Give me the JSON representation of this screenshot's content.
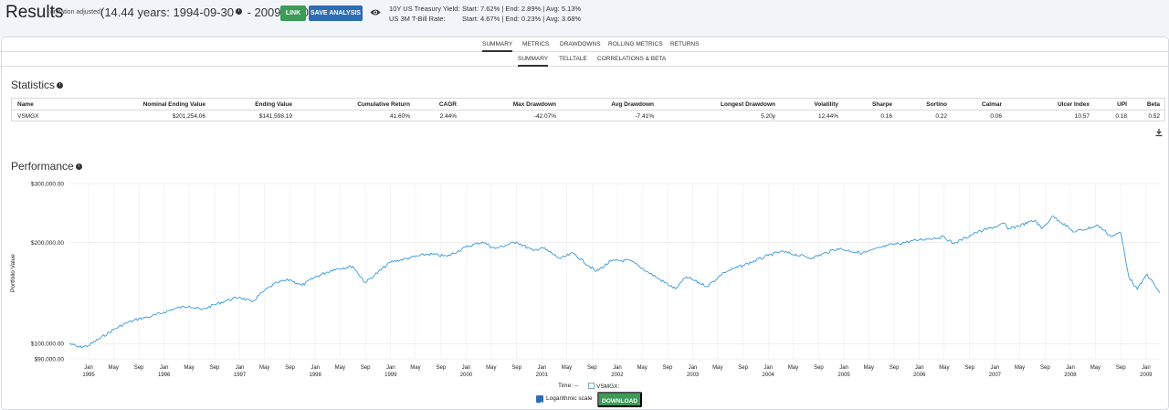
{
  "header": {
    "title": "Results",
    "inflation_note": "(inflation adjusted)",
    "years_prefix": "(14.44 years: 1994-09-30",
    "years_suffix": " - 2009-03-09)",
    "link_button": "LINK",
    "save_button": "SAVE ANALYSIS",
    "treasury_label": "10Y US Treasury Yield:",
    "treasury_values": "Start: 7.62%  |  End: 2.89%  |  Avg: 5.13%",
    "tbill_label": "US 3M T-Bill Rate:",
    "tbill_values": "Start: 4.67%  |  End: 0.23%  |  Avg: 3.68%"
  },
  "tabs": {
    "primary": [
      "SUMMARY",
      "METRICS",
      "DRAWDOWNS",
      "ROLLING METRICS",
      "RETURNS"
    ],
    "primary_active": "SUMMARY",
    "secondary": [
      "SUMMARY",
      "TELLTALE",
      "CORRELATIONS & BETA"
    ],
    "secondary_active": "SUMMARY"
  },
  "statistics": {
    "title": "Statistics",
    "columns": [
      "Name",
      "Nominal Ending Value",
      "Ending Value",
      "Cumulative Return",
      "CAGR",
      "Max Drawdown",
      "Avg Drawdown",
      "Longest Drawdown",
      "Volatility",
      "Sharpe",
      "Sortino",
      "Calmar",
      "Ulcer Index",
      "UPI",
      "Beta"
    ],
    "rows": [
      [
        "VSMGX",
        "$201,254.06",
        "$141,598.19",
        "41.60%",
        "2.44%",
        "-42.07%",
        "-7.41%",
        "5.20y",
        "12.44%",
        "0.16",
        "0.22",
        "0.06",
        "10.57",
        "0.18",
        "0.52"
      ]
    ]
  },
  "performance": {
    "title": "Performance",
    "time_label": "Time:",
    "time_value": "--",
    "series_legend": "VSMGX:",
    "log_scale_label": "Logarithmic scale",
    "download_button": "DOWNLOAD"
  },
  "chart_data": {
    "type": "line",
    "ylabel": "Portfolio Value",
    "yscale": "log",
    "ylim": [
      90000,
      300000
    ],
    "yticks": [
      "$300,000.00",
      "$200,000.00",
      "$100,000.00",
      "$90,000.00"
    ],
    "ytick_values": [
      300000,
      200000,
      100000,
      90000
    ],
    "xlim": [
      "1994-09-30",
      "2009-03-09"
    ],
    "x_ticks": [
      {
        "date": "1995-01",
        "label": "Jan",
        "year": "1995"
      },
      {
        "date": "1995-05",
        "label": "May"
      },
      {
        "date": "1995-09",
        "label": "Sep"
      },
      {
        "date": "1996-01",
        "label": "Jan",
        "year": "1996"
      },
      {
        "date": "1996-05",
        "label": "May"
      },
      {
        "date": "1996-09",
        "label": "Sep"
      },
      {
        "date": "1997-01",
        "label": "Jan",
        "year": "1997"
      },
      {
        "date": "1997-05",
        "label": "May"
      },
      {
        "date": "1997-09",
        "label": "Sep"
      },
      {
        "date": "1998-01",
        "label": "Jan",
        "year": "1998"
      },
      {
        "date": "1998-05",
        "label": "May"
      },
      {
        "date": "1998-09",
        "label": "Sep"
      },
      {
        "date": "1999-01",
        "label": "Jan",
        "year": "1999"
      },
      {
        "date": "1999-05",
        "label": "May"
      },
      {
        "date": "1999-09",
        "label": "Sep"
      },
      {
        "date": "2000-01",
        "label": "Jan",
        "year": "2000"
      },
      {
        "date": "2000-05",
        "label": "May"
      },
      {
        "date": "2000-09",
        "label": "Sep"
      },
      {
        "date": "2001-01",
        "label": "Jan",
        "year": "2001"
      },
      {
        "date": "2001-05",
        "label": "May"
      },
      {
        "date": "2001-09",
        "label": "Sep"
      },
      {
        "date": "2002-01",
        "label": "Jan",
        "year": "2002"
      },
      {
        "date": "2002-05",
        "label": "May"
      },
      {
        "date": "2002-09",
        "label": "Sep"
      },
      {
        "date": "2003-01",
        "label": "Jan",
        "year": "2003"
      },
      {
        "date": "2003-05",
        "label": "May"
      },
      {
        "date": "2003-09",
        "label": "Sep"
      },
      {
        "date": "2004-01",
        "label": "Jan",
        "year": "2004"
      },
      {
        "date": "2004-05",
        "label": "May"
      },
      {
        "date": "2004-09",
        "label": "Sep"
      },
      {
        "date": "2005-01",
        "label": "Jan",
        "year": "2005"
      },
      {
        "date": "2005-05",
        "label": "May"
      },
      {
        "date": "2005-09",
        "label": "Sep"
      },
      {
        "date": "2006-01",
        "label": "Jan",
        "year": "2006"
      },
      {
        "date": "2006-05",
        "label": "May"
      },
      {
        "date": "2006-09",
        "label": "Sep"
      },
      {
        "date": "2007-01",
        "label": "Jan",
        "year": "2007"
      },
      {
        "date": "2007-05",
        "label": "May"
      },
      {
        "date": "2007-09",
        "label": "Sep"
      },
      {
        "date": "2008-01",
        "label": "Jan",
        "year": "2008"
      },
      {
        "date": "2008-05",
        "label": "May"
      },
      {
        "date": "2008-09",
        "label": "Sep"
      },
      {
        "date": "2009-01",
        "label": "Jan",
        "year": "2009"
      }
    ],
    "series": [
      {
        "name": "VSMGX",
        "color": "#3a9ad9",
        "points": [
          [
            "1994-09-30",
            100000
          ],
          [
            "1994-11-15",
            97500
          ],
          [
            "1994-12-30",
            98500
          ],
          [
            "1995-03-01",
            104000
          ],
          [
            "1995-05-01",
            110000
          ],
          [
            "1995-07-01",
            115000
          ],
          [
            "1995-09-01",
            118500
          ],
          [
            "1995-11-01",
            120500
          ],
          [
            "1996-01-01",
            124000
          ],
          [
            "1996-03-01",
            127500
          ],
          [
            "1996-05-01",
            129500
          ],
          [
            "1996-07-01",
            126000
          ],
          [
            "1996-09-01",
            130500
          ],
          [
            "1996-11-01",
            134500
          ],
          [
            "1997-01-01",
            137500
          ],
          [
            "1997-03-01",
            133000
          ],
          [
            "1997-05-01",
            144000
          ],
          [
            "1997-07-01",
            152000
          ],
          [
            "1997-09-01",
            155000
          ],
          [
            "1997-10-28",
            149000
          ],
          [
            "1998-01-01",
            158000
          ],
          [
            "1998-04-01",
            166500
          ],
          [
            "1998-07-01",
            170000
          ],
          [
            "1998-08-31",
            152000
          ],
          [
            "1998-10-15",
            160000
          ],
          [
            "1999-01-01",
            175000
          ],
          [
            "1999-04-01",
            180000
          ],
          [
            "1999-07-01",
            185000
          ],
          [
            "1999-10-01",
            182000
          ],
          [
            "2000-01-01",
            194000
          ],
          [
            "2000-03-20",
            201000
          ],
          [
            "2000-05-20",
            192000
          ],
          [
            "2000-09-01",
            201000
          ],
          [
            "2000-11-20",
            189000
          ],
          [
            "2001-01-01",
            193500
          ],
          [
            "2001-04-01",
            179000
          ],
          [
            "2001-06-01",
            186000
          ],
          [
            "2001-09-21",
            164000
          ],
          [
            "2001-12-01",
            176000
          ],
          [
            "2002-03-01",
            177000
          ],
          [
            "2002-07-20",
            156000
          ],
          [
            "2002-10-09",
            145500
          ],
          [
            "2002-12-01",
            158000
          ],
          [
            "2003-03-11",
            148000
          ],
          [
            "2003-06-01",
            163000
          ],
          [
            "2003-09-01",
            171000
          ],
          [
            "2004-01-01",
            183000
          ],
          [
            "2004-03-01",
            188000
          ],
          [
            "2004-08-01",
            180000
          ],
          [
            "2004-12-01",
            192000
          ],
          [
            "2005-04-01",
            186000
          ],
          [
            "2005-08-01",
            196000
          ],
          [
            "2006-01-01",
            204000
          ],
          [
            "2006-05-01",
            208000
          ],
          [
            "2006-06-15",
            198500
          ],
          [
            "2006-10-01",
            214000
          ],
          [
            "2007-02-20",
            228000
          ],
          [
            "2007-03-05",
            219000
          ],
          [
            "2007-07-15",
            233000
          ],
          [
            "2007-08-15",
            220000
          ],
          [
            "2007-10-10",
            240000
          ],
          [
            "2008-01-20",
            215000
          ],
          [
            "2008-05-15",
            225000
          ],
          [
            "2008-07-15",
            209000
          ],
          [
            "2008-09-01",
            214000
          ],
          [
            "2008-10-10",
            158000
          ],
          [
            "2008-11-20",
            145000
          ],
          [
            "2009-01-06",
            161000
          ],
          [
            "2009-03-09",
            141600
          ]
        ]
      }
    ]
  }
}
